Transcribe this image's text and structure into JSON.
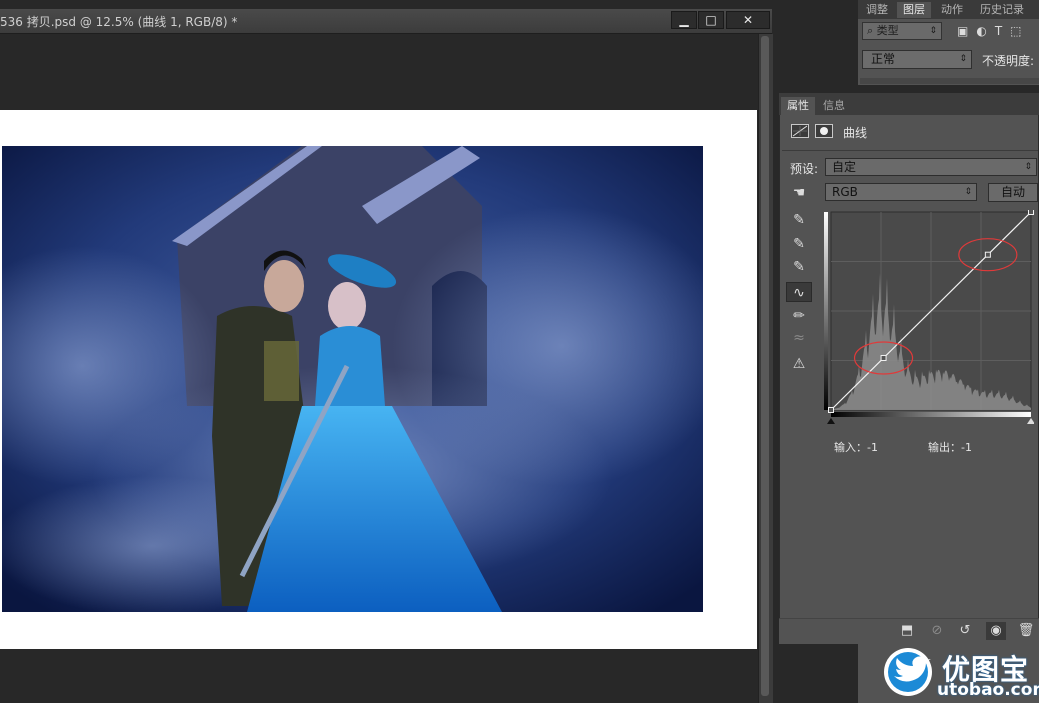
{
  "document": {
    "title": "536 拷贝.psd @ 12.5% (曲线 1, RGB/8) *",
    "minimize_label": "▁",
    "maximize_label": "□",
    "close_label": "✕"
  },
  "top_panel": {
    "tabs": [
      "调整",
      "图层",
      "动作",
      "历史记录"
    ],
    "active_tab": "图层",
    "kind_filter": "类型",
    "blend_mode": "正常",
    "opacity_label": "不透明度:"
  },
  "properties": {
    "tabs": [
      "属性",
      "信息"
    ],
    "active_tab": "属性",
    "adjustment_title": "曲线",
    "preset_label": "预设:",
    "preset_value": "自定",
    "channel_value": "RGB",
    "auto_button": "自动",
    "input_label": "输入：-1",
    "output_label": "输出：-1",
    "tools": [
      "hand-target-icon",
      "black-eyedropper-icon",
      "gray-eyedropper-icon",
      "white-eyedropper-icon",
      "curve-point-icon",
      "pencil-icon",
      "smooth-icon",
      "clipping-warning-icon"
    ],
    "bottom_icons": [
      "clip-to-layer-icon",
      "view-previous-icon",
      "reset-icon",
      "visibility-eye-icon",
      "trash-icon"
    ]
  },
  "curve": {
    "points": [
      [
        0,
        0
      ],
      [
        67,
        67
      ],
      [
        200,
        200
      ],
      [
        255,
        255
      ]
    ],
    "highlight_color": "#e03a3a"
  },
  "watermark": {
    "brand": "优图宝",
    "url": "utobao.com"
  },
  "colors": {
    "panel": "#535353",
    "workspace": "#282828",
    "brand_blue": "#1c6fb8"
  }
}
